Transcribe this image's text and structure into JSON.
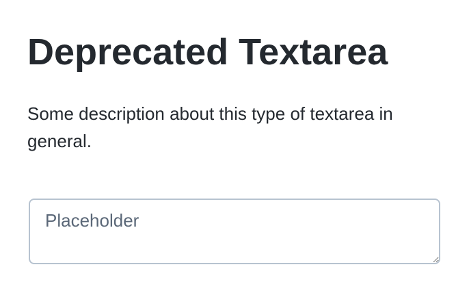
{
  "header": {
    "title": "Deprecated Textarea"
  },
  "content": {
    "description": "Some description about this type of textarea in general."
  },
  "textarea": {
    "value": "",
    "placeholder": "Placeholder"
  },
  "colors": {
    "text": "#24292f",
    "border": "#b7c3d0",
    "placeholder": "#5b6878",
    "background": "#ffffff"
  }
}
